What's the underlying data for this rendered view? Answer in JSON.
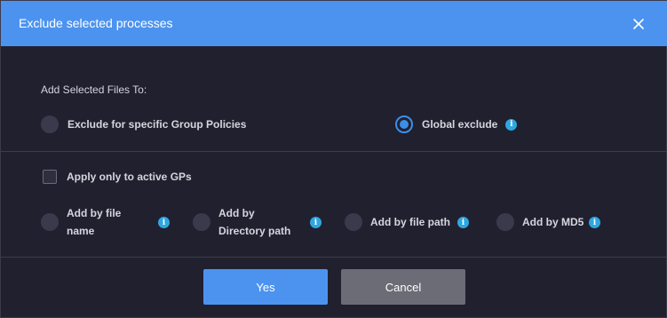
{
  "dialog": {
    "title": "Exclude selected processes",
    "close_icon": "close-icon"
  },
  "add_to": {
    "label": "Add Selected Files To:",
    "options": [
      {
        "label": "Exclude for specific Group Policies",
        "selected": false
      },
      {
        "label": "Global exclude",
        "selected": true,
        "info_icon": "info-icon"
      }
    ]
  },
  "active_gps": {
    "label": "Apply only to active GPs",
    "checked": false
  },
  "add_by": [
    {
      "line1": "Add by file",
      "line2": "name",
      "selected": false,
      "info_icon": "info-icon"
    },
    {
      "line1": "Add by",
      "line2": "Directory path",
      "selected": false,
      "info_icon": "info-icon"
    },
    {
      "line1": "Add by file path",
      "line2": "",
      "selected": false,
      "info_icon": "info-icon"
    },
    {
      "line1": "Add by MD5",
      "line2": "",
      "selected": false,
      "info_icon": "info-icon"
    }
  ],
  "buttons": {
    "yes": "Yes",
    "cancel": "Cancel"
  },
  "info_glyph": "i",
  "colors": {
    "header": "#4c93f0",
    "background": "#21202f",
    "accent": "#3b8ee8",
    "info": "#2ea7e0",
    "cancel": "#6b6c75"
  }
}
